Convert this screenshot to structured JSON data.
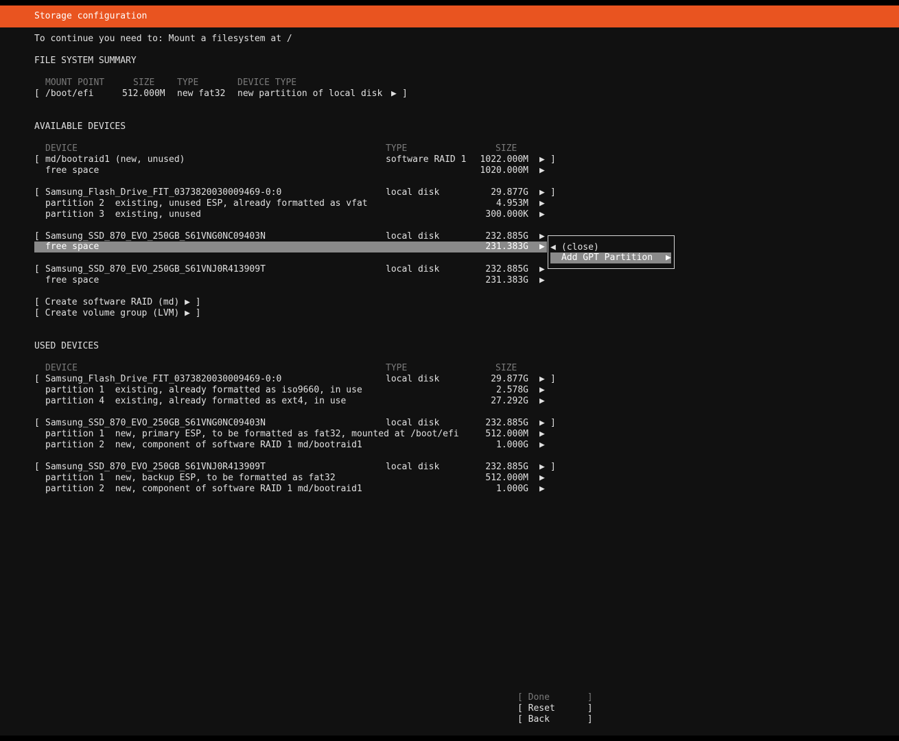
{
  "header": {
    "title": "Storage configuration"
  },
  "instruction": "To continue you need to: Mount a filesystem at /",
  "fs_summary": {
    "title": "FILE SYSTEM SUMMARY",
    "columns": {
      "mount": "MOUNT POINT",
      "size": "SIZE",
      "type": "TYPE",
      "device_type": "DEVICE TYPE"
    },
    "rows": [
      {
        "open": "[",
        "mount": "/boot/efi",
        "size": "512.000M",
        "type": "new fat32",
        "device_type": "new partition of local disk",
        "arrow": "▶",
        "close": "]"
      }
    ]
  },
  "available": {
    "title": "AVAILABLE DEVICES",
    "columns": {
      "device": "DEVICE",
      "type": "TYPE",
      "size": "SIZE"
    },
    "raid": {
      "open": "[",
      "name": "md/bootraid1 (new, unused)",
      "type": "software RAID 1",
      "size": "1022.000M",
      "arrow": "▶",
      "close": "]",
      "free_label": "free space",
      "free_size": "1020.000M",
      "free_arrow": "▶"
    },
    "flash": {
      "open": "[",
      "name": "Samsung_Flash_Drive_FIT_0373820030009469-0:0",
      "type": "local disk",
      "size": "29.877G",
      "arrow": "▶",
      "close": "]",
      "p2_label": "partition 2  existing, unused ESP, already formatted as vfat",
      "p2_size": "4.953M",
      "p2_arrow": "▶",
      "p3_label": "partition 3  existing, unused",
      "p3_size": "300.000K",
      "p3_arrow": "▶"
    },
    "ssd1": {
      "open": "[",
      "name": "Samsung_SSD_870_EVO_250GB_S61VNG0NC09403N",
      "type": "local disk",
      "size": "232.885G",
      "arrow": "▶",
      "free_label": "free space",
      "free_size": "231.383G",
      "free_arrow": "▶"
    },
    "ssd2": {
      "open": "[",
      "name": "Samsung_SSD_870_EVO_250GB_S61VNJ0R413909T",
      "type": "local disk",
      "size": "232.885G",
      "arrow": "▶",
      "free_label": "free space",
      "free_size": "231.383G",
      "free_arrow": "▶"
    },
    "create_raid": "[ Create software RAID (md) ▶ ]",
    "create_lvm": "[ Create volume group (LVM) ▶ ]"
  },
  "context_menu": {
    "close_arrow": "◀",
    "close_label": "(close)",
    "add_label": "Add GPT Partition",
    "add_arrow": "▶"
  },
  "used": {
    "title": "USED DEVICES",
    "columns": {
      "device": "DEVICE",
      "type": "TYPE",
      "size": "SIZE"
    },
    "flash": {
      "open": "[",
      "name": "Samsung_Flash_Drive_FIT_0373820030009469-0:0",
      "type": "local disk",
      "size": "29.877G",
      "arrow": "▶",
      "close": "]",
      "p1_label": "partition 1  existing, already formatted as iso9660, in use",
      "p1_size": "2.578G",
      "p1_arrow": "▶",
      "p4_label": "partition 4  existing, already formatted as ext4, in use",
      "p4_size": "27.292G",
      "p4_arrow": "▶"
    },
    "ssd1": {
      "open": "[",
      "name": "Samsung_SSD_870_EVO_250GB_S61VNG0NC09403N",
      "type": "local disk",
      "size": "232.885G",
      "arrow": "▶",
      "close": "]",
      "p1_label": "partition 1  new, primary ESP, to be formatted as fat32, mounted at /boot/efi",
      "p1_size": "512.000M",
      "p1_arrow": "▶",
      "p2_label": "partition 2  new, component of software RAID 1 md/bootraid1",
      "p2_size": "1.000G",
      "p2_arrow": "▶"
    },
    "ssd2": {
      "open": "[",
      "name": "Samsung_SSD_870_EVO_250GB_S61VNJ0R413909T",
      "type": "local disk",
      "size": "232.885G",
      "arrow": "▶",
      "close": "]",
      "p1_label": "partition 1  new, backup ESP, to be formatted as fat32",
      "p1_size": "512.000M",
      "p1_arrow": "▶",
      "p2_label": "partition 2  new, component of software RAID 1 md/bootraid1",
      "p2_size": "1.000G",
      "p2_arrow": "▶"
    }
  },
  "buttons": {
    "done": "[ Done       ]",
    "reset": "[ Reset      ]",
    "back": "[ Back       ]"
  },
  "colors": {
    "header": "#e95420",
    "background": "#111111",
    "highlight": "#8a8a8a"
  }
}
